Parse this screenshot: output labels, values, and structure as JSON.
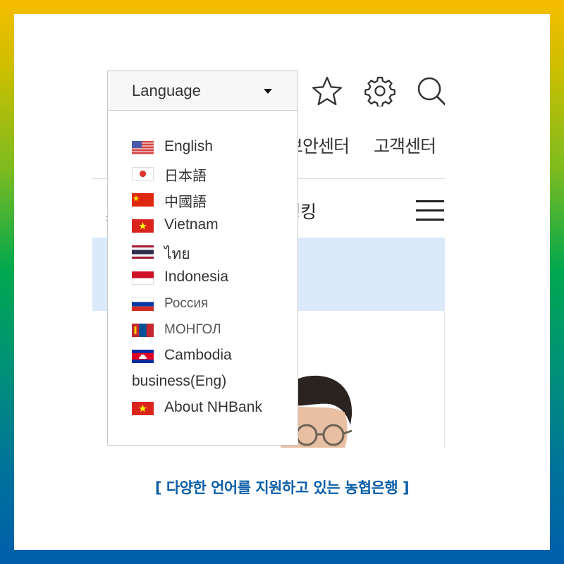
{
  "header": {
    "language_label": "Language",
    "nav_links": [
      "보안센터",
      "고객센터"
    ],
    "page_title_fragment": "뱅킹"
  },
  "language_menu": {
    "items": [
      {
        "label": "English",
        "flag": "us-flag"
      },
      {
        "label": "日本語",
        "flag": "japan-flag"
      },
      {
        "label": "中國語",
        "flag": "china-flag"
      },
      {
        "label": "Vietnam",
        "flag": "vietnam-flag"
      },
      {
        "label": "ไทย",
        "flag": "thailand-flag"
      },
      {
        "label": "Indonesia",
        "flag": "indonesia-flag"
      },
      {
        "label": "Россия",
        "flag": "russia-flag"
      },
      {
        "label": "МОНГОЛ",
        "flag": "mongolia-flag"
      },
      {
        "label": "Cambodia",
        "flag": "cambodia-flag"
      },
      {
        "label": "business(Eng)",
        "flag": ""
      },
      {
        "label": "About NHBank",
        "flag": "vietnam-flag"
      }
    ]
  },
  "caption": "[ 다양한 언어를 지원하고 있는 농협은행 ]",
  "colors": {
    "frame_top": "#f7bd00",
    "frame_mid": "#00a84f",
    "frame_bottom": "#005eaa",
    "caption": "#0b5ea8",
    "banner": "#dce9fb"
  }
}
